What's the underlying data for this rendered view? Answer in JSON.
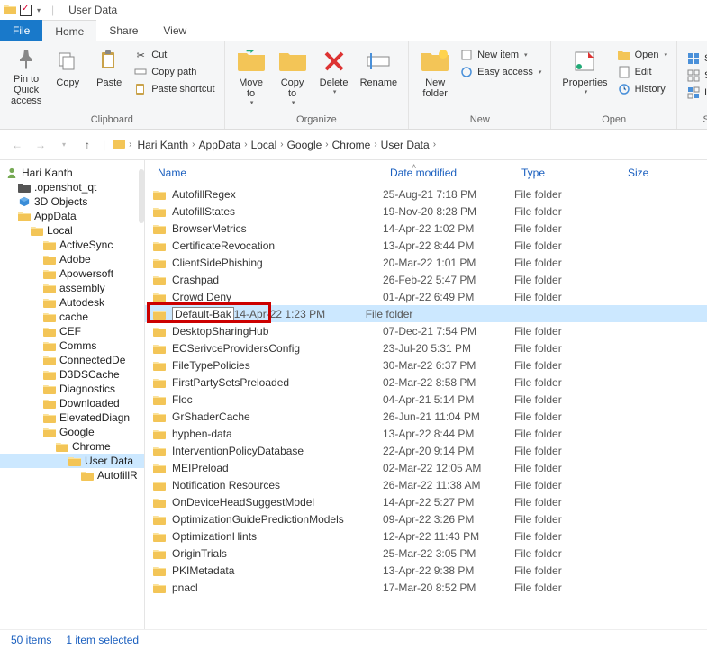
{
  "title": "User Data",
  "tabs": {
    "file": "File",
    "home": "Home",
    "share": "Share",
    "view": "View"
  },
  "ribbon": {
    "clipboard": {
      "label": "Clipboard",
      "pin": "Pin to Quick\naccess",
      "copy": "Copy",
      "paste": "Paste",
      "cut": "Cut",
      "copypath": "Copy path",
      "pasteshortcut": "Paste shortcut"
    },
    "organize": {
      "label": "Organize",
      "moveto": "Move\nto",
      "copyto": "Copy\nto",
      "delete": "Delete",
      "rename": "Rename"
    },
    "new": {
      "label": "New",
      "newfolder": "New\nfolder",
      "newitem": "New item",
      "easyaccess": "Easy access"
    },
    "open": {
      "label": "Open",
      "properties": "Properties",
      "open": "Open",
      "edit": "Edit",
      "history": "History"
    },
    "select": {
      "label": "Se",
      "selectall": "Select",
      "selectnone": "Select",
      "invert": "Invert"
    }
  },
  "breadcrumbs": [
    "Hari Kanth",
    "AppData",
    "Local",
    "Google",
    "Chrome",
    "User Data"
  ],
  "tree": [
    {
      "indent": 0,
      "icon": "user",
      "label": "Hari Kanth"
    },
    {
      "indent": 1,
      "icon": "folder-dark",
      "label": ".openshot_qt"
    },
    {
      "indent": 1,
      "icon": "3d",
      "label": "3D Objects"
    },
    {
      "indent": 1,
      "icon": "folder",
      "label": "AppData"
    },
    {
      "indent": 2,
      "icon": "folder",
      "label": "Local"
    },
    {
      "indent": 3,
      "icon": "folder",
      "label": "ActiveSync"
    },
    {
      "indent": 3,
      "icon": "folder",
      "label": "Adobe"
    },
    {
      "indent": 3,
      "icon": "folder",
      "label": "Apowersoft"
    },
    {
      "indent": 3,
      "icon": "folder",
      "label": "assembly"
    },
    {
      "indent": 3,
      "icon": "folder",
      "label": "Autodesk"
    },
    {
      "indent": 3,
      "icon": "folder",
      "label": "cache"
    },
    {
      "indent": 3,
      "icon": "folder",
      "label": "CEF"
    },
    {
      "indent": 3,
      "icon": "folder",
      "label": "Comms"
    },
    {
      "indent": 3,
      "icon": "folder",
      "label": "ConnectedDe",
      "clip": true
    },
    {
      "indent": 3,
      "icon": "folder",
      "label": "D3DSCache"
    },
    {
      "indent": 3,
      "icon": "folder",
      "label": "Diagnostics"
    },
    {
      "indent": 3,
      "icon": "folder",
      "label": "Downloaded",
      "clip": true
    },
    {
      "indent": 3,
      "icon": "folder",
      "label": "ElevatedDiagn",
      "clip": true
    },
    {
      "indent": 3,
      "icon": "folder",
      "label": "Google"
    },
    {
      "indent": 4,
      "icon": "folder",
      "label": "Chrome"
    },
    {
      "indent": 5,
      "icon": "folder",
      "label": "User Data",
      "selected": true
    },
    {
      "indent": 6,
      "icon": "folder",
      "label": "AutofillR",
      "clip": true
    }
  ],
  "columns": {
    "name": "Name",
    "date": "Date modified",
    "type": "Type",
    "size": "Size"
  },
  "rows": [
    {
      "name": "AutofillRegex",
      "date": "25-Aug-21 7:18 PM",
      "type": "File folder"
    },
    {
      "name": "AutofillStates",
      "date": "19-Nov-20 8:28 PM",
      "type": "File folder"
    },
    {
      "name": "BrowserMetrics",
      "date": "14-Apr-22 1:02 PM",
      "type": "File folder"
    },
    {
      "name": "CertificateRevocation",
      "date": "13-Apr-22 8:44 PM",
      "type": "File folder"
    },
    {
      "name": "ClientSidePhishing",
      "date": "20-Mar-22 1:01 PM",
      "type": "File folder"
    },
    {
      "name": "Crashpad",
      "date": "26-Feb-22 5:47 PM",
      "type": "File folder"
    },
    {
      "name": "Crowd Deny",
      "date": "01-Apr-22 6:49 PM",
      "type": "File folder"
    },
    {
      "name": "Default-Bak",
      "date": "14-Apr-22 1:23 PM",
      "type": "File folder",
      "selected": true,
      "highlight": true
    },
    {
      "name": "DesktopSharingHub",
      "date": "07-Dec-21 7:54 PM",
      "type": "File folder"
    },
    {
      "name": "ECSerivceProvidersConfig",
      "date": "23-Jul-20 5:31 PM",
      "type": "File folder"
    },
    {
      "name": "FileTypePolicies",
      "date": "30-Mar-22 6:37 PM",
      "type": "File folder"
    },
    {
      "name": "FirstPartySetsPreloaded",
      "date": "02-Mar-22 8:58 PM",
      "type": "File folder"
    },
    {
      "name": "Floc",
      "date": "04-Apr-21 5:14 PM",
      "type": "File folder"
    },
    {
      "name": "GrShaderCache",
      "date": "26-Jun-21 11:04 PM",
      "type": "File folder"
    },
    {
      "name": "hyphen-data",
      "date": "13-Apr-22 8:44 PM",
      "type": "File folder"
    },
    {
      "name": "InterventionPolicyDatabase",
      "date": "22-Apr-20 9:14 PM",
      "type": "File folder"
    },
    {
      "name": "MEIPreload",
      "date": "02-Mar-22 12:05 AM",
      "type": "File folder"
    },
    {
      "name": "Notification Resources",
      "date": "26-Mar-22 11:38 AM",
      "type": "File folder"
    },
    {
      "name": "OnDeviceHeadSuggestModel",
      "date": "14-Apr-22 5:27 PM",
      "type": "File folder"
    },
    {
      "name": "OptimizationGuidePredictionModels",
      "date": "09-Apr-22 3:26 PM",
      "type": "File folder"
    },
    {
      "name": "OptimizationHints",
      "date": "12-Apr-22 11:43 PM",
      "type": "File folder"
    },
    {
      "name": "OriginTrials",
      "date": "25-Mar-22 3:05 PM",
      "type": "File folder"
    },
    {
      "name": "PKIMetadata",
      "date": "13-Apr-22 9:38 PM",
      "type": "File folder"
    },
    {
      "name": "pnacl",
      "date": "17-Mar-20 8:52 PM",
      "type": "File folder"
    }
  ],
  "status": {
    "count": "50 items",
    "selected": "1 item selected"
  }
}
